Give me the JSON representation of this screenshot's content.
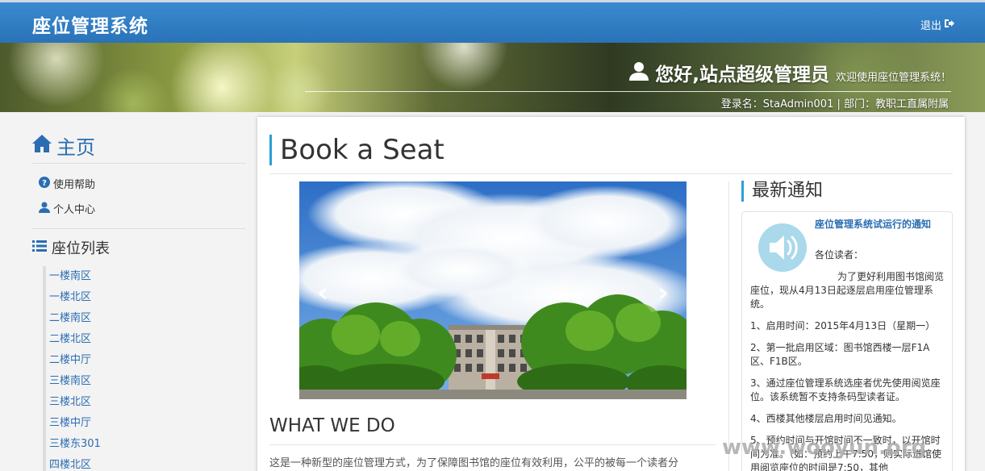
{
  "header": {
    "brand": "座位管理系统",
    "logout_label": "退出"
  },
  "banner": {
    "greeting": "您好,站点超级管理员",
    "welcome": "欢迎使用座位管理系统！",
    "login_info": "登录名：StaAdmin001 | 部门：教职工直属附属"
  },
  "sidebar": {
    "home_label": "主页",
    "menu": [
      {
        "label": "使用帮助",
        "icon": "question-circle-icon"
      },
      {
        "label": "个人中心",
        "icon": "user-icon"
      }
    ],
    "seat_list_title": "座位列表",
    "seats": [
      "一楼南区",
      "一楼北区",
      "二楼南区",
      "二楼北区",
      "二楼中厅",
      "三楼南区",
      "三楼北区",
      "三楼中厅",
      "三楼东301",
      "四楼北区"
    ]
  },
  "main": {
    "title": "Book a Seat",
    "what_title": "WHAT WE DO",
    "what_text": "这是一种新型的座位管理方式，为了保障图书馆的座位有效利用，公平的被每一个读者分"
  },
  "notice": {
    "section_title": "最新通知",
    "headline": "座位管理系统试运行的通知",
    "salutation": "各位读者：",
    "paragraphs": [
      "为了更好利用图书馆阅览座位，现从4月13日起逐层启用座位管理系统。",
      "1、启用时间：2015年4月13日（星期一）",
      "2、第一批启用区域：图书馆西楼一层F1A区、F1B区。",
      "3、通过座位管理系统选座者优先使用阅览座位。该系统暂不支持条码型读者证。",
      "4、西楼其他楼层启用时间见通知。",
      "5、预约时间与开馆时间不一致时，以开馆时间为准。（如：预约上午7:50，则实际进馆使用阅览座位的时间是7:50，其他"
    ]
  },
  "watermark": "www.wooyun.org",
  "colors": {
    "topbar": "#2a73b8",
    "accent": "#2a9fd6",
    "link": "#2a6db3"
  }
}
